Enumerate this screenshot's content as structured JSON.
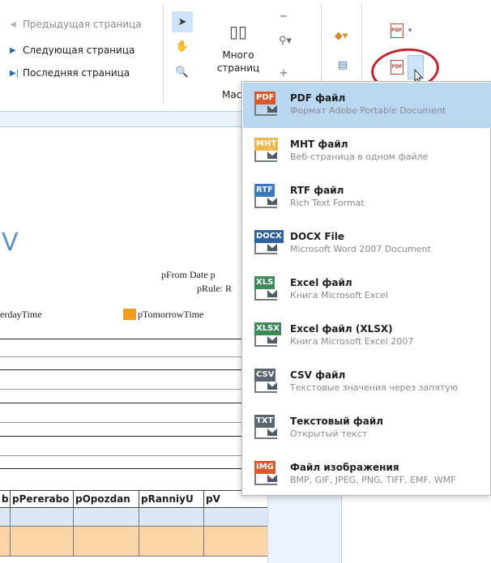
{
  "ribbon": {
    "nav": {
      "previous": "Предыдущая страница",
      "next": "Следующая страница",
      "last": "Последняя страница"
    },
    "many_pages": {
      "line1": "Много",
      "line2": "страниц"
    },
    "group_label": "Мас",
    "pdf_badge": "PDF"
  },
  "report": {
    "partial_letter": "V",
    "from_date": "pFrom Date p",
    "rule": "pRule: R",
    "legend_left": "erdayTime",
    "legend_right": "pTomorrowTime",
    "columns": [
      "b",
      "pPererabo",
      "pOpozdan",
      "pRanniyU",
      "pV"
    ]
  },
  "export_menu": {
    "items": [
      {
        "badge": "PDF",
        "badge_color": "#d9582e",
        "title": "PDF файл",
        "subtitle": "Формат Adobe Portable Document",
        "selected": true
      },
      {
        "badge": "MHT",
        "badge_color": "#f0b850",
        "title": "MHT файл",
        "subtitle": "Веб-страница в одном файле",
        "selected": false
      },
      {
        "badge": "RTF",
        "badge_color": "#3a78c2",
        "title": "RTF файл",
        "subtitle": "Rich Text Format",
        "selected": false
      },
      {
        "badge": "DOCX",
        "badge_color": "#2f5f9e",
        "title": "DOCX File",
        "subtitle": "Microsoft Word 2007 Document",
        "selected": false
      },
      {
        "badge": "XLS",
        "badge_color": "#3d8a5a",
        "title": "Excel файл",
        "subtitle": "Книга Microsoft Excel",
        "selected": false
      },
      {
        "badge": "XLSX",
        "badge_color": "#3d8a5a",
        "title": "Excel файл (XLSX)",
        "subtitle": "Книга Microsoft Excel 2007",
        "selected": false
      },
      {
        "badge": "CSV",
        "badge_color": "#5a6570",
        "title": "CSV файл",
        "subtitle": "Текстовые значения через запятую",
        "selected": false
      },
      {
        "badge": "TXT",
        "badge_color": "#5a6570",
        "title": "Текстовый файл",
        "subtitle": "Открытый текст",
        "selected": false
      },
      {
        "badge": "IMG",
        "badge_color": "#d9582e",
        "title": "Файл изображения",
        "subtitle": "BMP, GIF, JPEG, PNG, TIFF, EMF, WMF",
        "selected": false
      }
    ]
  },
  "colors": {
    "accent_selection": "#b9d7f0",
    "highlight_orange": "#f79a1e",
    "annotation_red": "#c0262d"
  }
}
